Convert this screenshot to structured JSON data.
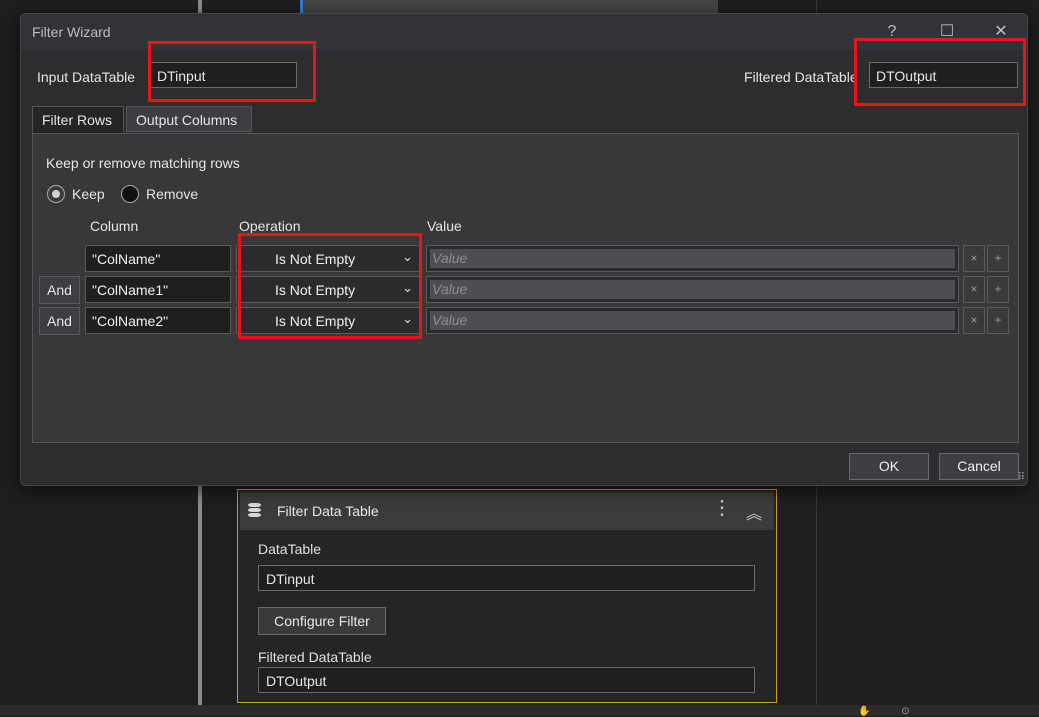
{
  "dialog": {
    "title": "Filter Wizard",
    "help": "?",
    "maximize": "☐",
    "close": "✕",
    "input_label": "Input DataTable",
    "input_value": "DTinput",
    "output_label": "Filtered DataTable",
    "output_value": "DTOutput",
    "tabs": [
      "Filter Rows",
      "Output Columns"
    ],
    "keep_remove_label": "Keep or remove matching rows",
    "radio_keep": "Keep",
    "radio_remove": "Remove",
    "col_headers": {
      "column": "Column",
      "operation": "Operation",
      "value": "Value"
    },
    "rows": [
      {
        "connector": "",
        "column": "\"ColName\"",
        "operation": "Is Not Empty",
        "value_placeholder": "Value"
      },
      {
        "connector": "And",
        "column": "\"ColName1\"",
        "operation": "Is Not Empty",
        "value_placeholder": "Value"
      },
      {
        "connector": "And",
        "column": "\"ColName2\"",
        "operation": "Is Not Empty",
        "value_placeholder": "Value"
      }
    ],
    "remove_glyph": "×",
    "add_glyph": "+",
    "ok": "OK",
    "cancel": "Cancel"
  },
  "activity": {
    "title": "Filter Data Table",
    "datatable_label": "DataTable",
    "datatable_value": "DTinput",
    "configure_button": "Configure Filter",
    "filtered_label": "Filtered DataTable",
    "filtered_value": "DTOutput"
  },
  "colors": {
    "highlight": "#e8141a",
    "activity_border": "#d19a1b"
  }
}
